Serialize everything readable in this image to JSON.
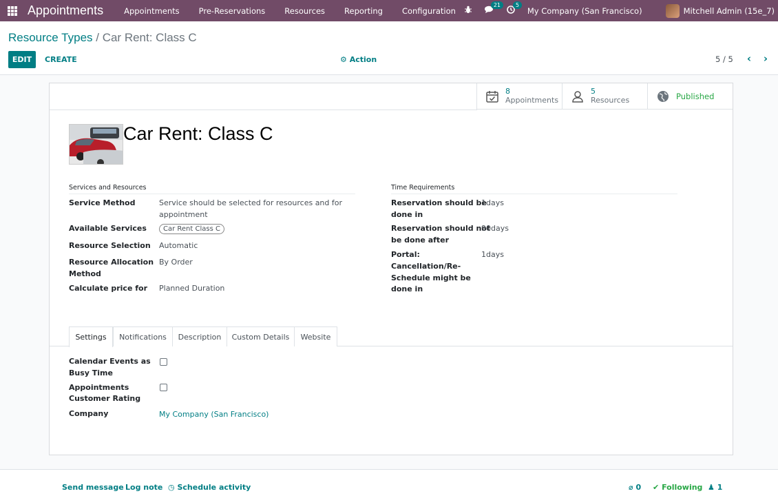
{
  "navbar": {
    "brand": "Appointments",
    "menu": [
      "Appointments",
      "Pre-Reservations",
      "Resources",
      "Reporting",
      "Configuration"
    ],
    "messages_badge": "21",
    "activities_badge": "5",
    "company": "My Company (San Francisco)",
    "user": "Mitchell Admin (15e_7)"
  },
  "breadcrumb": {
    "parent": "Resource Types",
    "separator": " / ",
    "current": "Car Rent: Class C"
  },
  "toolbar": {
    "edit": "EDIT",
    "create": "CREATE",
    "action": "Action",
    "pager": "5 / 5"
  },
  "stat_buttons": {
    "appointments_count": "8",
    "appointments_label": "Appointments",
    "resources_count": "5",
    "resources_label": "Resources",
    "published": "Published"
  },
  "record": {
    "title": "Car Rent: Class C"
  },
  "services_group": {
    "title": "Services and Resources",
    "service_method_label": "Service Method",
    "service_method_value_1": "Service should be selected for resources and for",
    "service_method_value_2": "appointment",
    "available_services_label": "Available Services",
    "available_services_tag": "Car Rent Class C",
    "resource_selection_label": "Resource Selection",
    "resource_selection_value": "Automatic",
    "allocation_label_1": "Resource Allocation",
    "allocation_label_2": "Method",
    "allocation_value": "By Order",
    "price_label": "Calculate price for",
    "price_value": "Planned Duration"
  },
  "time_group": {
    "title": "Time Requirements",
    "before_label_1": "Reservation should be",
    "before_label_2": "done in",
    "before_value": "1days",
    "after_label_1": "Reservation should not",
    "after_label_2": "be done after",
    "after_value": "90days",
    "portal_label_1": "Portal:",
    "portal_label_2": "Cancellation/Re-",
    "portal_label_3": "Schedule might be",
    "portal_label_4": "done in",
    "portal_value": "1days"
  },
  "tabs": [
    "Settings",
    "Notifications",
    "Description",
    "Custom Details",
    "Website"
  ],
  "settings": {
    "busy_label_1": "Calendar Events as",
    "busy_label_2": "Busy Time",
    "busy_checked": false,
    "rating_label_1": "Appointments",
    "rating_label_2": "Customer Rating",
    "rating_checked": false,
    "company_label": "Company",
    "company_value": "My Company (San Francisco)"
  },
  "chatter": {
    "send_message": "Send message",
    "log_note": "Log note",
    "schedule_activity": "Schedule activity",
    "attachments": "0",
    "following": "Following",
    "followers": "1"
  },
  "colors": {
    "navbar": "#714b67",
    "accent": "#017e84",
    "published": "#28a745"
  }
}
